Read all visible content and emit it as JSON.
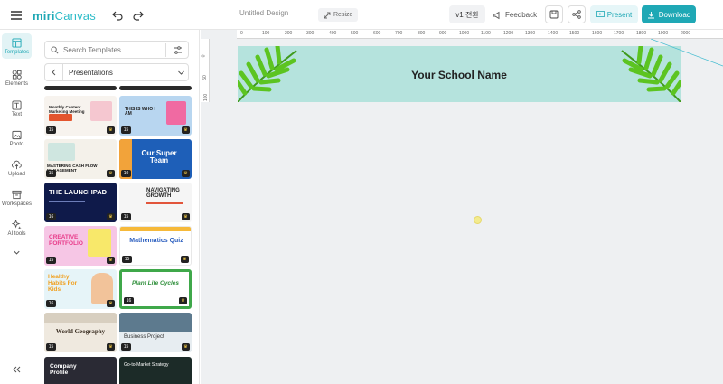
{
  "app": {
    "logo_main": "miri",
    "logo_sub": "Canvas",
    "doc_title": "Untitled Design",
    "resize_label": "Resize",
    "version_label": "v1 전환",
    "feedback_label": "Feedback",
    "present_label": "Present",
    "download_label": "Download"
  },
  "rail": {
    "items": [
      {
        "label": "Templates",
        "icon": "layout-icon"
      },
      {
        "label": "Elements",
        "icon": "shapes-icon"
      },
      {
        "label": "Text",
        "icon": "text-icon"
      },
      {
        "label": "Photo",
        "icon": "image-icon"
      },
      {
        "label": "Upload",
        "icon": "cloud-upload-icon"
      },
      {
        "label": "Workspaces",
        "icon": "archive-icon"
      },
      {
        "label": "AI tools",
        "icon": "sparkle-icon"
      }
    ]
  },
  "panel": {
    "search_placeholder": "Search Templates",
    "category": "Presentations",
    "templates": [
      {
        "title": "Monthly Content Marketing Meeting",
        "count": "15"
      },
      {
        "title": "THIS IS WHO I AM",
        "count": "15"
      },
      {
        "title": "MASTERING CASH FLOW MANAGEMENT",
        "count": "15"
      },
      {
        "title": "Our Super Team",
        "count": "10"
      },
      {
        "title": "THE LAUNCHPAD",
        "count": "16"
      },
      {
        "title": "NAVIGATING GROWTH",
        "count": "15"
      },
      {
        "title": "CREATIVE PORTFOLIO",
        "count": "15"
      },
      {
        "title": "Mathematics Quiz",
        "count": "15"
      },
      {
        "title": "Healthy Habits For Kids",
        "count": "16"
      },
      {
        "title": "Plant Life Cycles",
        "count": "16"
      },
      {
        "title": "World Geography",
        "count": "15"
      },
      {
        "title": "Business Project",
        "count": "15"
      },
      {
        "title": "Company Profile",
        "count": ""
      },
      {
        "title": "Go-to-Market Strategy",
        "count": ""
      }
    ]
  },
  "ruler": {
    "top": [
      "0",
      "100",
      "200",
      "300",
      "400",
      "500",
      "600",
      "700",
      "800",
      "900",
      "1000",
      "1100",
      "1200",
      "1300",
      "1400",
      "1500",
      "1600",
      "1700",
      "1800",
      "1900",
      "2000"
    ],
    "left": [
      "0",
      "50",
      "100"
    ]
  },
  "slide": {
    "title": "Your School Name",
    "bg_color": "#b5e3dd"
  },
  "colors": {
    "accent": "#1fa8b5"
  }
}
